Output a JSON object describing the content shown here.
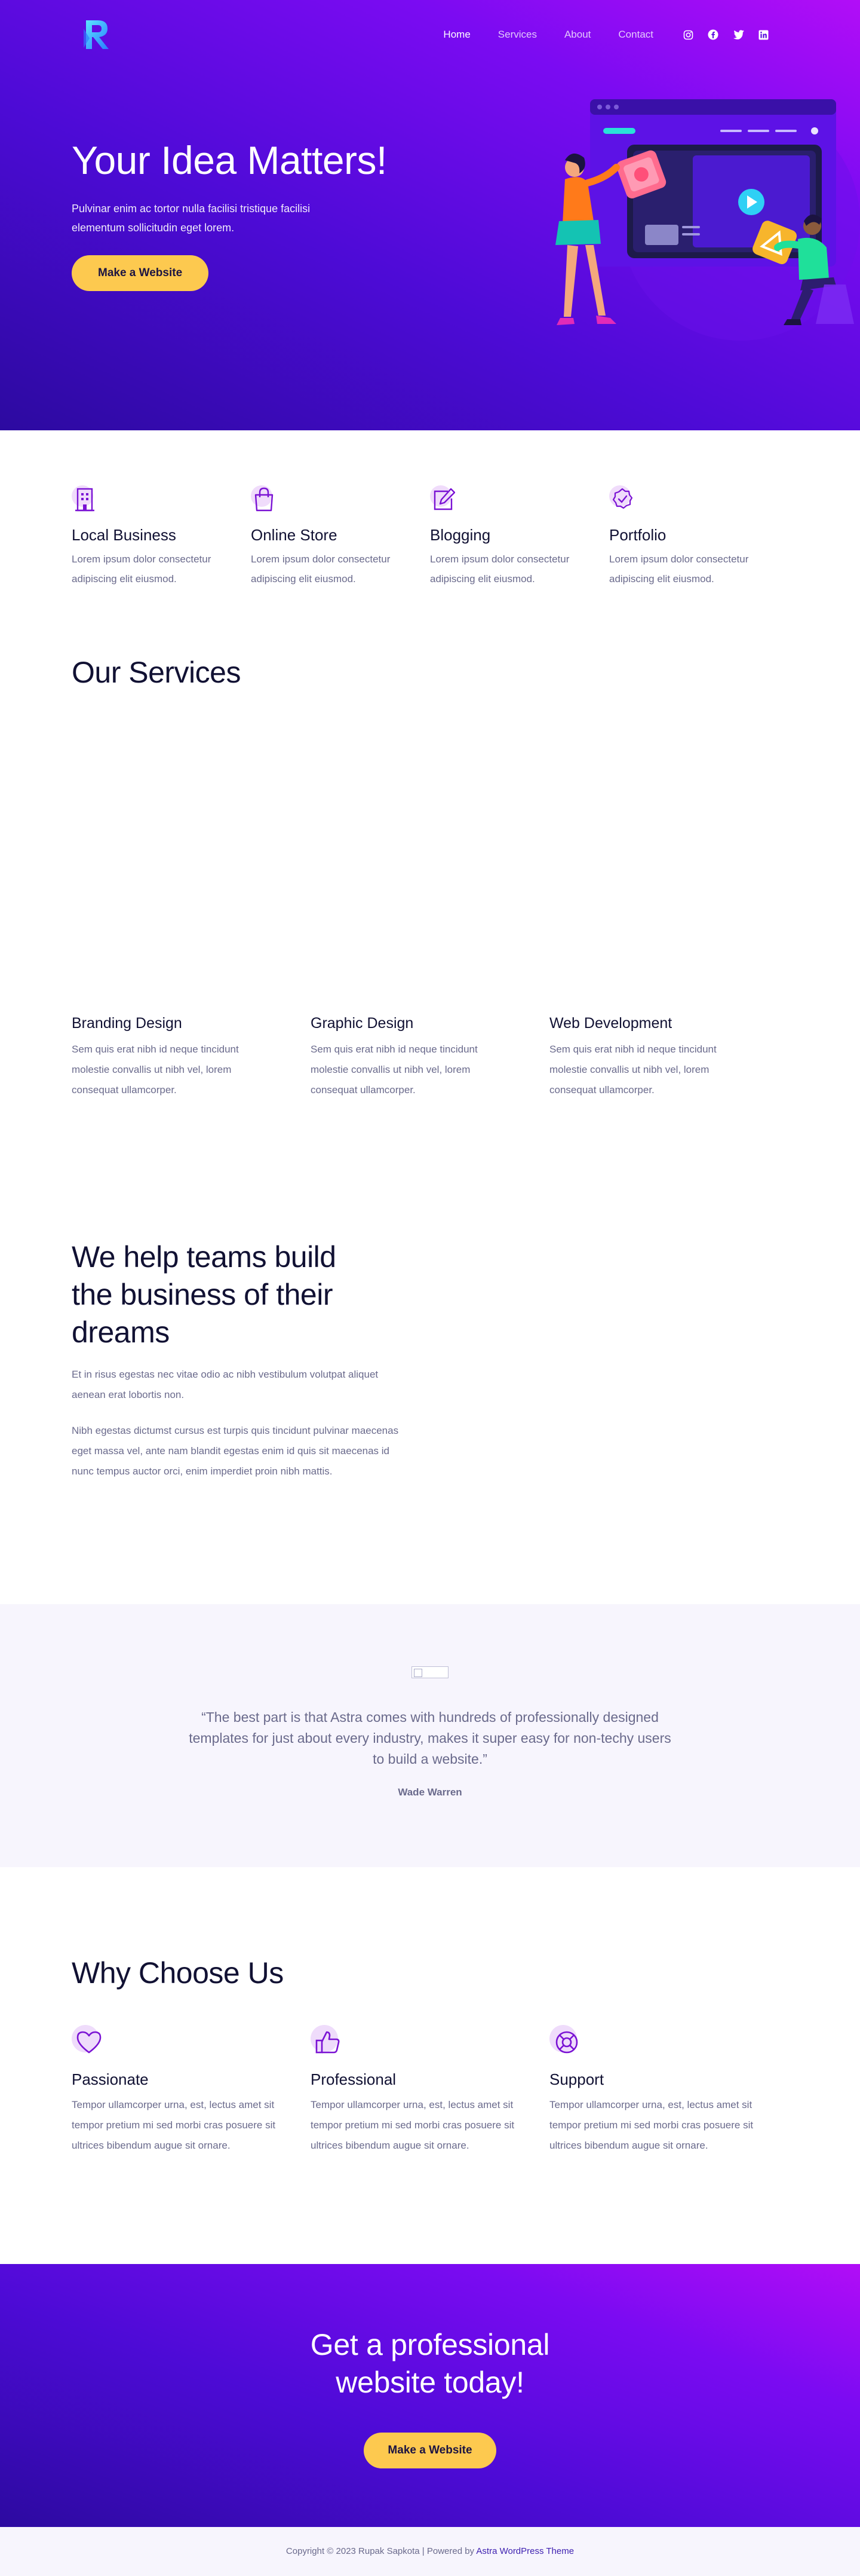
{
  "colors": {
    "hero_gradient": [
      "#2c0aa0",
      "#4d0bd6",
      "#7b0bf2",
      "#b20df7"
    ],
    "accent_yellow": "#fdc94f",
    "icon_purple": "#7a12d4",
    "text_dark": "#111133",
    "text_muted": "#6a6a8c",
    "soft_bg": "#f7f5fd"
  },
  "header": {
    "logo_icon": "r-logo-icon",
    "nav": [
      {
        "label": "Home",
        "active": true
      },
      {
        "label": "Services",
        "active": false
      },
      {
        "label": "About",
        "active": false
      },
      {
        "label": "Contact",
        "active": false
      }
    ],
    "social_icons": [
      "instagram-icon",
      "facebook-icon",
      "twitter-icon",
      "linkedin-icon"
    ]
  },
  "hero": {
    "title": "Your Idea Matters!",
    "subtitle": "Pulvinar enim ac tortor nulla facilisi tristique facilisi elementum sollicitudin eget lorem.",
    "button": "Make a Website"
  },
  "features": [
    {
      "icon": "building-icon",
      "title": "Local Business",
      "text": "Lorem ipsum dolor consectetur adipiscing elit eiusmod."
    },
    {
      "icon": "shopping-bag-icon",
      "title": "Online Store",
      "text": "Lorem ipsum dolor consectetur adipiscing elit eiusmod."
    },
    {
      "icon": "edit-icon",
      "title": "Blogging",
      "text": "Lorem ipsum dolor consectetur adipiscing elit eiusmod."
    },
    {
      "icon": "badge-check-icon",
      "title": "Portfolio",
      "text": "Lorem ipsum dolor consectetur adipiscing elit eiusmod."
    }
  ],
  "services": {
    "title": "Our Services",
    "items": [
      {
        "title": "Branding Design",
        "text": "Sem quis erat nibh id neque tincidunt molestie convallis ut nibh vel, lorem consequat ullamcorper."
      },
      {
        "title": "Graphic Design",
        "text": "Sem quis erat nibh id neque tincidunt molestie convallis ut nibh vel, lorem consequat ullamcorper."
      },
      {
        "title": "Web Development",
        "text": "Sem quis erat nibh id neque tincidunt molestie convallis ut nibh vel, lorem consequat ullamcorper."
      }
    ]
  },
  "help": {
    "title": "We help teams build the business of their dreams",
    "p1": "Et in risus egestas nec vitae odio ac nibh vestibulum volutpat aliquet aenean erat lobortis non.",
    "p2": "Nibh egestas dictumst cursus est turpis quis tincidunt pulvinar maecenas eget massa vel, ante nam blandit egestas enim id quis sit maecenas id nunc tempus auctor orci, enim imperdiet proin nibh mattis."
  },
  "testimonial": {
    "quote": "“The best part is that Astra comes with hundreds of professionally designed templates for just about every industry, makes it super easy for non-techy users to build a website.”",
    "author": "Wade Warren"
  },
  "why": {
    "title": "Why Choose Us",
    "items": [
      {
        "icon": "heart-icon",
        "title": "Passionate",
        "text": "Tempor ullamcorper urna, est, lectus amet sit tempor pretium mi sed morbi cras posuere sit ultrices bibendum augue sit ornare."
      },
      {
        "icon": "thumbs-up-icon",
        "title": "Professional",
        "text": "Tempor ullamcorper urna, est, lectus amet sit tempor pretium mi sed morbi cras posuere sit ultrices bibendum augue sit ornare."
      },
      {
        "icon": "lifebuoy-icon",
        "title": "Support",
        "text": "Tempor ullamcorper urna, est, lectus amet sit tempor pretium mi sed morbi cras posuere sit ultrices bibendum augue sit ornare."
      }
    ]
  },
  "cta": {
    "title": "Get a professional website today!",
    "button": "Make a Website"
  },
  "footer": {
    "copyright": "Copyright © 2023 Rupak Sapkota | Powered by ",
    "link": "Astra WordPress Theme"
  }
}
